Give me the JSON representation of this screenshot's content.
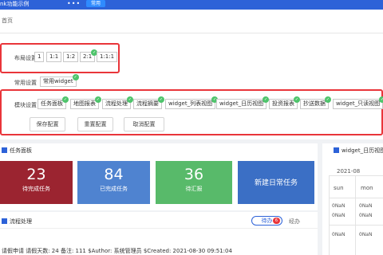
{
  "topbar": {
    "title": "nk功能示例",
    "more": "•••",
    "tag": "常用"
  },
  "breadcrumb": "首页",
  "layout_setting": {
    "label": "布局设置",
    "options": [
      "1",
      "1:1",
      "1:2",
      "2:1",
      "1:1:1"
    ],
    "selected": "2:1"
  },
  "common_setting": {
    "label": "常用设置",
    "chip": "常用widget"
  },
  "module_setting": {
    "label": "模块设置",
    "modules": [
      "任务面板",
      "地图报表",
      "流程处理",
      "流程摘要",
      "widget_列表视图",
      "widget_日历视图",
      "投资报表",
      "抄送数据",
      "widget_只读视图"
    ]
  },
  "buttons": {
    "save": "保存配置",
    "reset": "重置配置",
    "cancel": "取消配置"
  },
  "task_panel": {
    "title": "任务面板",
    "cards": [
      {
        "value": "23",
        "label": "待完成任务",
        "color": "#9b2430"
      },
      {
        "value": "84",
        "label": "已完成任务",
        "color": "#4f83d0"
      },
      {
        "value": "36",
        "label": "待汇报",
        "color": "#58ba6a"
      },
      {
        "label": "新建日常任务",
        "color": "#3b6fc5"
      }
    ]
  },
  "process": {
    "title": "流程处理",
    "tabs": {
      "todo": "待办",
      "todo_count": "6",
      "done": "经办"
    },
    "row": "请假申请  请假天数: 24 备注: 111 $Author: 系统管理员 $Created: 2021-08-30 09:51:04"
  },
  "calendar": {
    "title": "widget_日历视图",
    "month": "2021-08",
    "days": [
      "sun",
      "mon"
    ],
    "cells": [
      "0NaN",
      "0NaN",
      "0NaN",
      "0NaN",
      "0NaN",
      "0NaN"
    ]
  },
  "colors": {
    "brand": "#2d62d8",
    "highlight": "#e9353a",
    "check": "#4ec46b"
  }
}
